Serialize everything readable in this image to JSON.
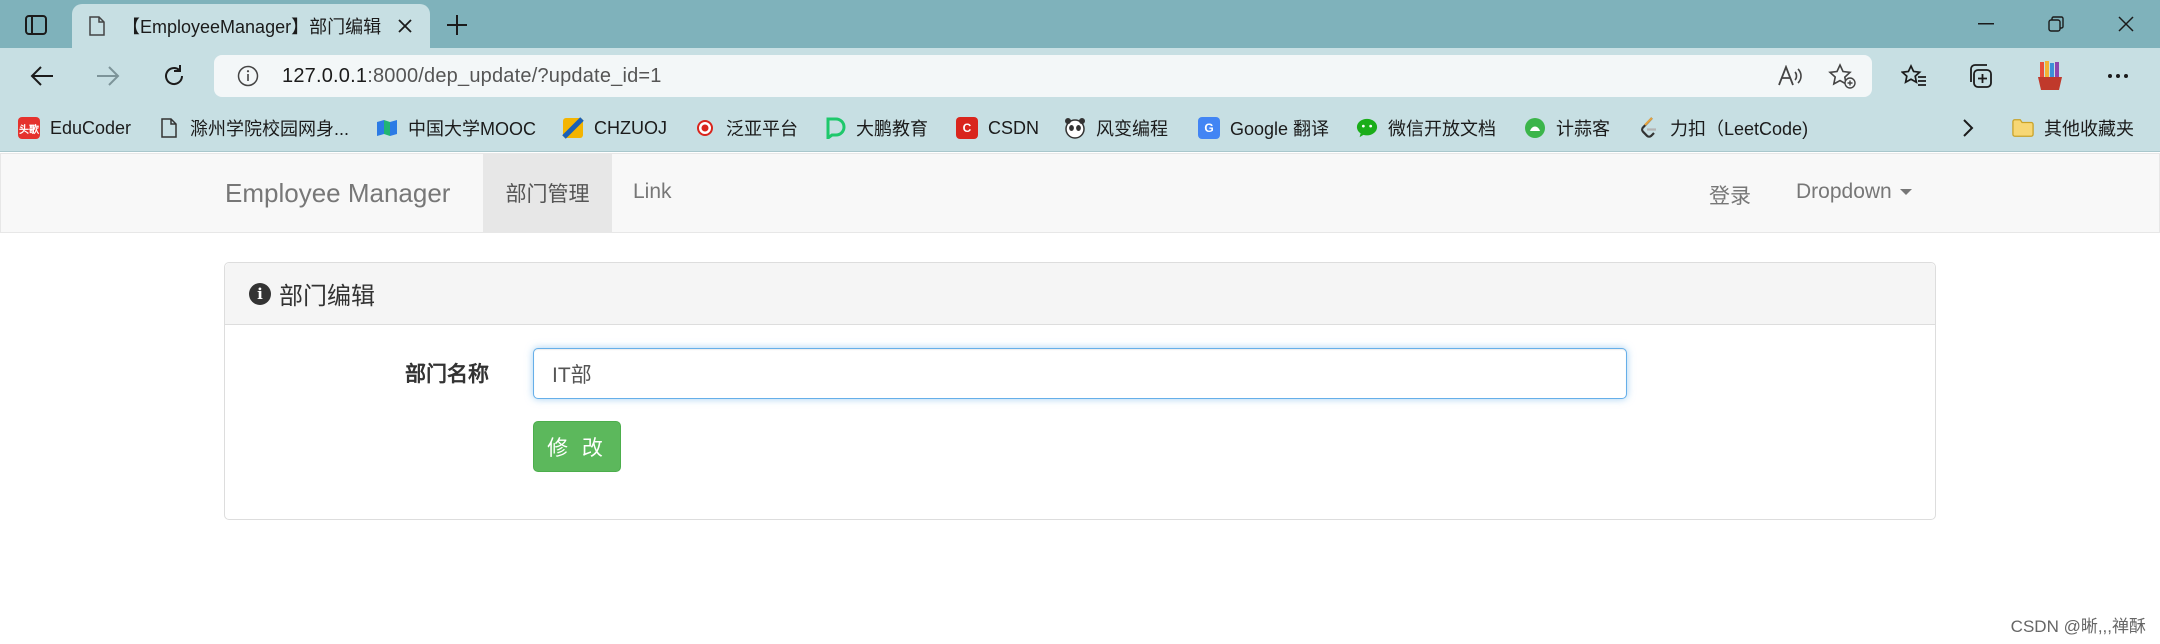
{
  "browser": {
    "tab": {
      "title": "【EmployeeManager】部门编辑",
      "icon": "page-icon"
    },
    "address": {
      "host": "127.0.0.1",
      "rest": ":8000/dep_update/?update_id=1"
    },
    "bookmarks": [
      {
        "label": "EduCoder",
        "icon": "toutiao-icon",
        "color": "#e5322d",
        "badge": "头歌"
      },
      {
        "label": "滁州学院校园网身...",
        "icon": "page-icon",
        "color": "#333333",
        "badge": ""
      },
      {
        "label": "中国大学MOOC",
        "icon": "mooc-icon",
        "color": "#2c7be5",
        "badge": ""
      },
      {
        "label": "CHZUOJ",
        "icon": "chzuoj-icon",
        "color": "#f4b400",
        "badge": ""
      },
      {
        "label": "泛亚平台",
        "icon": "fanya-icon",
        "color": "#d9251c",
        "badge": ""
      },
      {
        "label": "大鹏教育",
        "icon": "dapeng-icon",
        "color": "#1ec86b",
        "badge": ""
      },
      {
        "label": "CSDN",
        "icon": "csdn-icon",
        "color": "#d9251c",
        "badge": "C"
      },
      {
        "label": "风变编程",
        "icon": "panda-icon",
        "color": "#444444",
        "badge": ""
      },
      {
        "label": "Google 翻译",
        "icon": "google-translate-icon",
        "color": "#4285f4",
        "badge": "G"
      },
      {
        "label": "微信开放文档",
        "icon": "wechat-icon",
        "color": "#1aad19",
        "badge": ""
      },
      {
        "label": "计蒜客",
        "icon": "jisuanke-icon",
        "color": "#3bb54a",
        "badge": ""
      },
      {
        "label": "力扣（LeetCode)",
        "icon": "leetcode-icon",
        "color": "#e7a33e",
        "badge": ""
      }
    ],
    "other_bookmarks": "其他收藏夹"
  },
  "navbar": {
    "brand": "Employee Manager",
    "items": [
      {
        "label": "部门管理",
        "active": true
      },
      {
        "label": "Link",
        "active": false
      }
    ],
    "right": {
      "login": "登录",
      "dropdown": "Dropdown"
    }
  },
  "panel": {
    "heading": "部门编辑",
    "field_label": "部门名称",
    "field_value": "IT部",
    "submit_label": "修 改"
  },
  "watermark": "CSDN @晰,,,禅酥"
}
